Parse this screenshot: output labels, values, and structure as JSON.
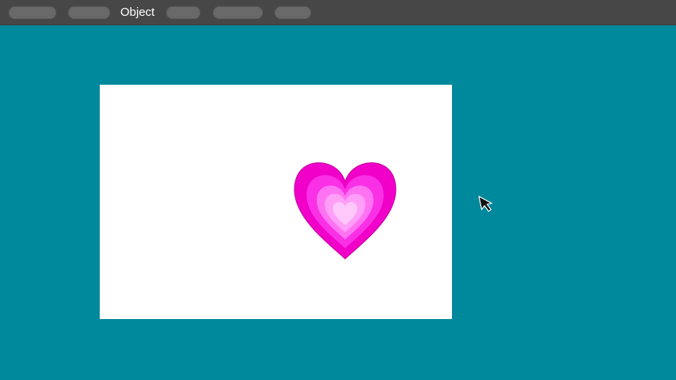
{
  "menubar": {
    "items": [
      {
        "label": "",
        "active": false
      },
      {
        "label": "",
        "active": false
      },
      {
        "label": "Object",
        "active": true
      },
      {
        "label": "",
        "active": false
      },
      {
        "label": "",
        "active": false
      },
      {
        "label": "",
        "active": false
      }
    ]
  },
  "canvas": {
    "workspace_color": "#00889c",
    "artboard_color": "#ffffff",
    "object": {
      "type": "heart-icon",
      "layer_colors": [
        "#f000c8",
        "#fa30e6",
        "#ff73f2",
        "#ff9ff8",
        "#ffc8fb"
      ],
      "outline_color": "#c4009c"
    }
  },
  "cursor": {
    "type": "arrow-pointer-icon"
  }
}
